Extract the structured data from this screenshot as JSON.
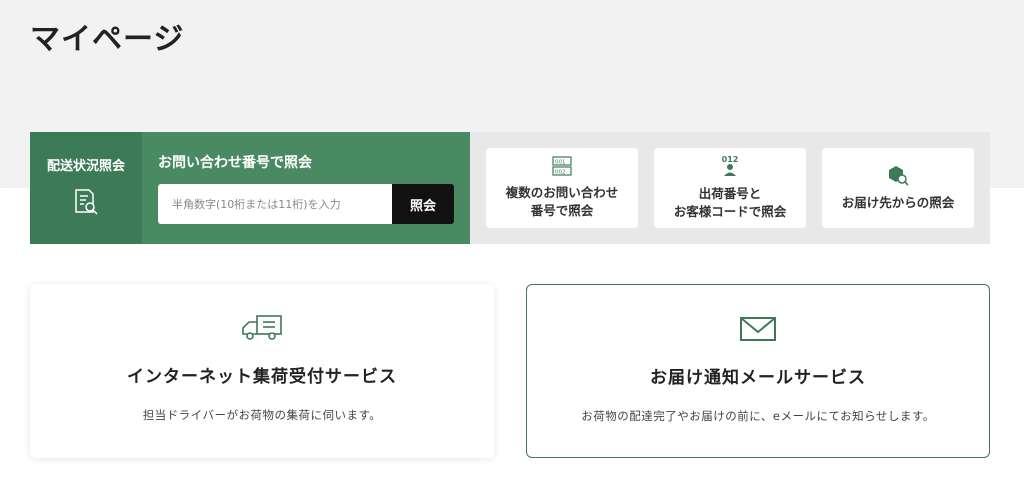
{
  "page": {
    "title": "マイページ"
  },
  "tracking": {
    "label": "配送状況照会",
    "inquiry_heading": "お問い合わせ番号で照会",
    "inquiry_placeholder": "半角数字(10桁または11桁)を入力",
    "inquiry_value": "",
    "submit_label": "照会",
    "options": [
      {
        "label": "複数のお問い合わせ\n番号で照会",
        "icon": "multiple-numbers-icon"
      },
      {
        "label": "出荷番号と\nお客様コードで照会",
        "icon": "customer-code-icon",
        "icon_text": "012"
      },
      {
        "label": "お届け先からの照会",
        "icon": "package-search-icon"
      }
    ]
  },
  "services": [
    {
      "title": "インターネット集荷受付サービス",
      "description": "担当ドライバーがお荷物の集荷に伺います。",
      "icon": "truck-icon"
    },
    {
      "title": "お届け通知メールサービス",
      "description": "お荷物の配達完了やお届けの前に、eメールにてお知らせします。",
      "icon": "envelope-icon"
    }
  ],
  "colors": {
    "brand_green_dark": "#3c7a58",
    "brand_green": "#4a8a63",
    "button_black": "#111111",
    "background_gray": "#f2f2f2"
  }
}
